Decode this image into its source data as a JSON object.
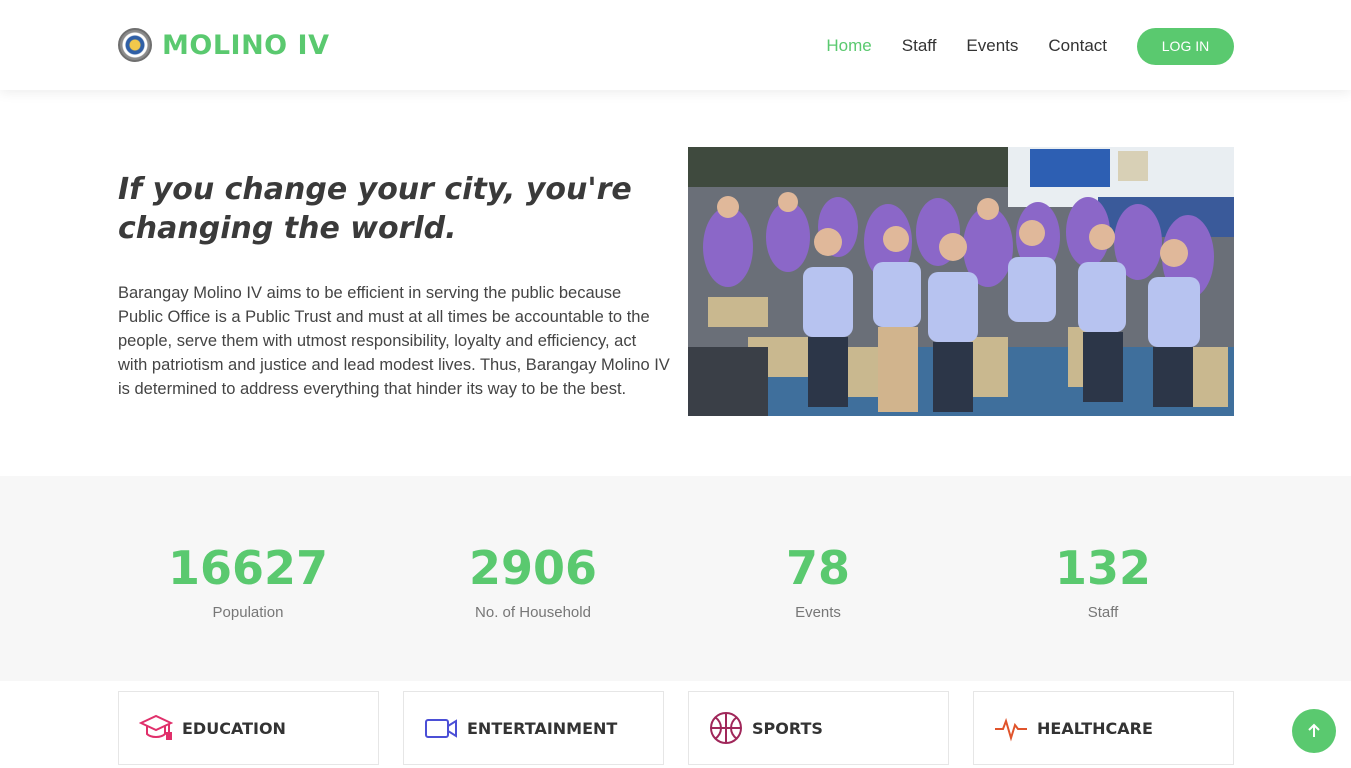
{
  "header": {
    "brand": "MOLINO IV",
    "nav": [
      "Home",
      "Staff",
      "Events",
      "Contact"
    ],
    "login_label": "LOG IN"
  },
  "hero": {
    "title": "If you change your city, you're changing the world.",
    "text": "Barangay Molino IV aims to be efficient in serving the public because Public Office is a Public Trust and must at all times be accountable to the people, serve them with utmost responsibility, loyalty and efficiency, act with patriotism and justice and lead modest lives. Thus, Barangay Molino IV is determined to address everything that hinder its way to be the best."
  },
  "stats": [
    {
      "value": "16627",
      "label": "Population"
    },
    {
      "value": "2906",
      "label": "No. of Household"
    },
    {
      "value": "78",
      "label": "Events"
    },
    {
      "value": "132",
      "label": "Staff"
    }
  ],
  "categories": [
    {
      "label": "EDUCATION",
      "icon": "graduation-cap-icon",
      "color": "#e0306b"
    },
    {
      "label": "ENTERTAINMENT",
      "icon": "video-camera-icon",
      "color": "#4b4fd6"
    },
    {
      "label": "SPORTS",
      "icon": "basketball-icon",
      "color": "#a0275a"
    },
    {
      "label": "HEALTHCARE",
      "icon": "pulse-icon",
      "color": "#e0542c"
    }
  ],
  "colors": {
    "accent": "#5ac96f"
  },
  "back_to_top_icon": "arrow-up-icon"
}
